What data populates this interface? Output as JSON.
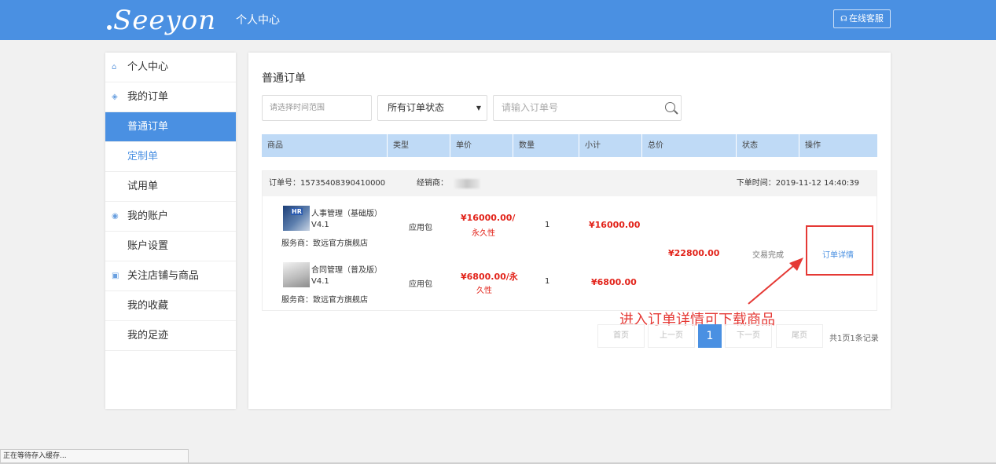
{
  "header": {
    "logo": "Seeyon",
    "title": "个人中心",
    "service_button": "在线客服",
    "service_icon": "headset-icon"
  },
  "sidebar": {
    "items": [
      {
        "label": "个人中心",
        "type": "group",
        "icon": "home-icon"
      },
      {
        "label": "我的订单",
        "type": "group",
        "icon": "cube-icon"
      },
      {
        "label": "普通订单",
        "type": "active"
      },
      {
        "label": "定制单",
        "type": "link"
      },
      {
        "label": "试用单",
        "type": "normal"
      },
      {
        "label": "我的账户",
        "type": "group",
        "icon": "account-icon"
      },
      {
        "label": "账户设置",
        "type": "normal"
      },
      {
        "label": "关注店铺与商品",
        "type": "group",
        "icon": "follow-icon"
      },
      {
        "label": "我的收藏",
        "type": "normal"
      },
      {
        "label": "我的足迹",
        "type": "normal"
      }
    ]
  },
  "main": {
    "title": "普通订单",
    "filters": {
      "date_placeholder": "请选择时间范围",
      "status_value": "所有订单状态",
      "order_placeholder": "请输入订单号"
    },
    "columns": [
      "商品",
      "类型",
      "单价",
      "数量",
      "小计",
      "总价",
      "状态",
      "操作"
    ],
    "order": {
      "order_no": "订单号：15735408390410000",
      "dealer_label": "经销商：",
      "order_time": "下单时间：2019-11-12 14:40:39",
      "total": "¥22800.00",
      "status": "交易完成",
      "action": "订单详情",
      "products": [
        {
          "name": "人事管理（基础版）",
          "version": "V4.1",
          "provider": "服务商：致远官方旗舰店",
          "type": "应用包",
          "price": "¥16000.00/",
          "price_unit": "永久性",
          "qty": "1",
          "subtotal": "¥16000.00",
          "thumb_text": "HR"
        },
        {
          "name": "合同管理（普及版）",
          "version": "V4.1",
          "provider": "服务商：致远官方旗舰店",
          "type": "应用包",
          "price": "¥6800.00/永",
          "price_unit": "久性",
          "qty": "1",
          "subtotal": "¥6800.00"
        }
      ]
    },
    "annotation": "进入订单详情可下载商品",
    "pagination": {
      "first": "首页",
      "prev": "上一页",
      "current": "1",
      "next": "下一页",
      "last": "尾页",
      "info": "共1页1条记录"
    }
  },
  "status_bar": "正在等待存入缓存..."
}
